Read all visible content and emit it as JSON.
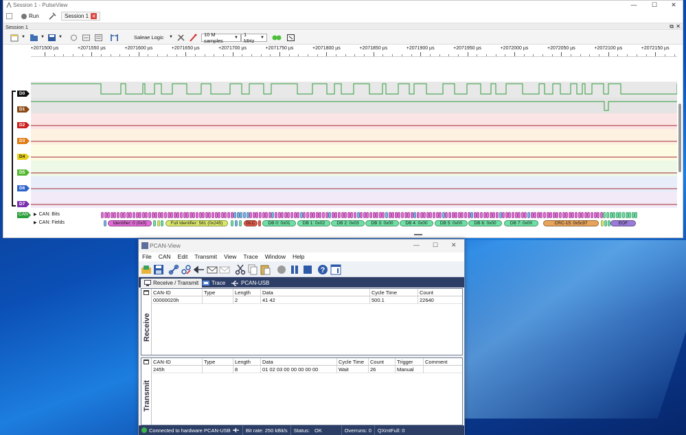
{
  "pulseview": {
    "title": "Session 1 - PulseView",
    "run_label": "Run",
    "session_tab": "Session 1",
    "session_bar": "Session 1",
    "device": "Saleae Logic",
    "samples": "10 M samples",
    "rate": "1 MHz",
    "ruler_ticks": [
      "+2071500 µs",
      "+2071550 µs",
      "+2071600 µs",
      "+2071650 µs",
      "+2071700 µs",
      "+2071750 µs",
      "+2071800 µs",
      "+2071850 µs",
      "+2071900 µs",
      "+2071950 µs",
      "+2072000 µs",
      "+2072050 µs",
      "+2072100 µs",
      "+2072150 µs"
    ],
    "channels": [
      {
        "name": "D0",
        "color": "#111111",
        "lane_bg": "#e8e8e8",
        "line": "#2e9b3a"
      },
      {
        "name": "D1",
        "color": "#8b4a14",
        "lane_bg": "#e4e4e4",
        "line": "#2e9b3a"
      },
      {
        "name": "D2",
        "color": "#cc1f1f",
        "lane_bg": "#fbe4e4",
        "line": "#a3262e"
      },
      {
        "name": "D3",
        "color": "#e07a12",
        "lane_bg": "#fdf1e1",
        "line": "#a3262e"
      },
      {
        "name": "D4",
        "color": "#e6cf1a",
        "lane_bg": "#fdfbe2",
        "line": "#a3262e"
      },
      {
        "name": "D5",
        "color": "#54b830",
        "lane_bg": "#eef8e6",
        "line": "#a3262e"
      },
      {
        "name": "D6",
        "color": "#2e63c9",
        "lane_bg": "#e8eef9",
        "line": "#a3262e"
      },
      {
        "name": "D7",
        "color": "#7a2fae",
        "lane_bg": "#f2eaf7",
        "line": "#a3262e"
      }
    ],
    "decoder_tag": "CAN",
    "bits_label": "CAN: Bits",
    "fields_label": "CAN: Fields",
    "fields": [
      {
        "label": "Identifier: 0 (0x0)",
        "color": "#e16bd6"
      },
      {
        "label": "Full Identifier: 581 (0x245)",
        "color": "#d9e86a"
      },
      {
        "label": "DLC",
        "color": "#e05c4c"
      },
      {
        "label": "DB 0: 0x01",
        "color": "#6fe0a4"
      },
      {
        "label": "DB 1: 0x02",
        "color": "#6fe0a4"
      },
      {
        "label": "DB 2: 0x03",
        "color": "#6fe0a4"
      },
      {
        "label": "DB 3: 0x00",
        "color": "#6fe0a4"
      },
      {
        "label": "DB 4: 0x00",
        "color": "#6fe0a4"
      },
      {
        "label": "DB 5: 0x00",
        "color": "#6fe0a4"
      },
      {
        "label": "DB 6: 0x00",
        "color": "#6fe0a4"
      },
      {
        "label": "DB 7: 0x00",
        "color": "#6fe0a4"
      },
      {
        "label": "CRC-15: 0x5c97",
        "color": "#e7a35a"
      },
      {
        "label": "EOF",
        "color": "#9a7bd9"
      }
    ],
    "colors": {
      "bit_a": "#e46fd8",
      "bit_b": "#7db3e8",
      "bit_c": "#6fe0a4"
    }
  },
  "pcan": {
    "title": "PCAN-View",
    "menu": [
      "File",
      "CAN",
      "Edit",
      "Transmit",
      "View",
      "Trace",
      "Window",
      "Help"
    ],
    "tabs": [
      "Receive / Transmit",
      "Trace",
      "PCAN-USB"
    ],
    "receive": {
      "side_label": "Receive",
      "headers": [
        "CAN-ID",
        "Type",
        "Length",
        "Data",
        "Cycle Time",
        "Count"
      ],
      "row": [
        "00000020h",
        "",
        "2",
        "41 42",
        "500.1",
        "22640"
      ]
    },
    "transmit": {
      "side_label": "Transmit",
      "headers": [
        "CAN-ID",
        "Type",
        "Length",
        "Data",
        "Cycle Time",
        "Count",
        "Trigger",
        "Comment"
      ],
      "row": [
        "245h",
        "",
        "8",
        "01 02 03 00 00 00 00 00",
        "Wait",
        "26",
        "Manual",
        ""
      ]
    },
    "status": {
      "connection": "Connected to hardware PCAN-USB",
      "bitrate": "Bit rate: 250 kBit/s",
      "status_label": "Status:",
      "status_value": "OK",
      "overruns": "Overruns: 0",
      "qxmtfull": "QXmtFull: 0"
    }
  }
}
